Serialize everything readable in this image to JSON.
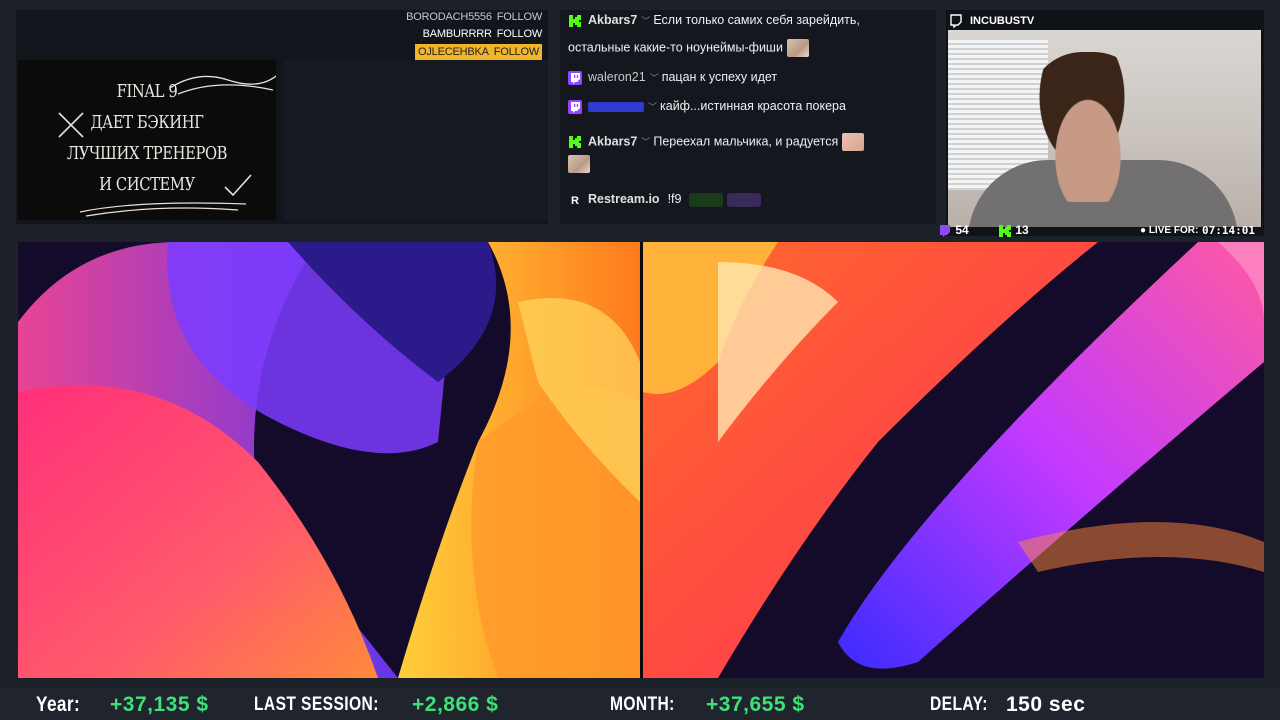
{
  "followers": [
    {
      "name": "BORODACH5556",
      "action": "FOLLOW"
    },
    {
      "name": "BAMBURRRR",
      "action": "FOLLOW"
    },
    {
      "name": "OJLECEHBKA",
      "action": "FOLLOW"
    }
  ],
  "promo": {
    "lines": [
      "FINAL 9",
      "ДАЕТ БЭКИНГ",
      "ЛУЧШИХ ТРЕНЕРОВ",
      "И СИСТЕМУ"
    ]
  },
  "chat": {
    "messages": [
      {
        "platform": "kick",
        "user": "Akbars7",
        "text1": "Если только самих себя зарейдить,",
        "text2": "остальные какие-то ноунеймы-фиши"
      },
      {
        "platform": "twitch",
        "user": "waleron21",
        "text1": "пацан к успеху идет"
      },
      {
        "platform": "twitch",
        "user": "",
        "text1": "кайф...истинная красота покера"
      },
      {
        "platform": "kick",
        "user": "Akbars7",
        "text1": "Переехал мальчика, и радуется"
      },
      {
        "platform": "restream",
        "user": "Restream.io",
        "text1": "!f9"
      }
    ]
  },
  "cam": {
    "channel": "INCUBUSTV",
    "twitch_viewers": "54",
    "kick_viewers": "13",
    "live_label": "LIVE FOR:",
    "live_time": "07:14:01"
  },
  "stats": {
    "year_label": "Year:",
    "year_value": "+37,135 $",
    "session_label": "LAST SESSION:",
    "session_value": "+2,866 $",
    "month_label": "MONTH:",
    "month_value": "+37,655 $",
    "delay_label": "DELAY:",
    "delay_value": "150 sec"
  },
  "colors": {
    "profit_green": "#3ee07a",
    "follow_highlight": "#f0b52a",
    "twitch_purple": "#9146ff",
    "kick_green": "#53fc18"
  }
}
